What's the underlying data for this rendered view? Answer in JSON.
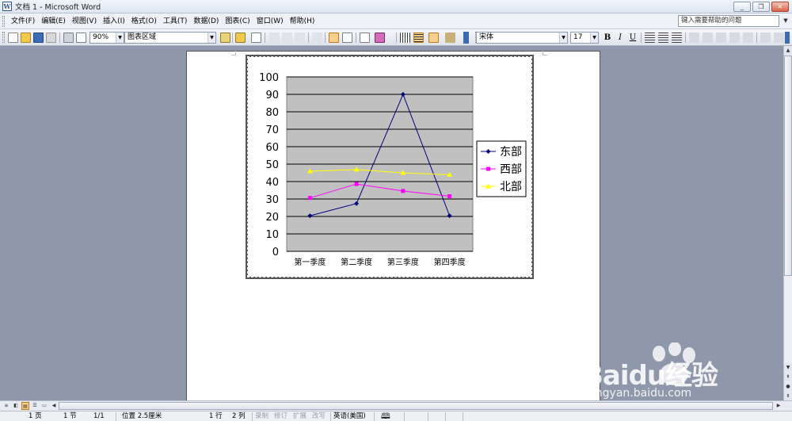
{
  "window": {
    "title": "文档 1 - Microsoft Word",
    "buttons": {
      "minimize": "_",
      "restore": "❐",
      "close": "✕"
    }
  },
  "menubar": {
    "items": [
      "文件(F)",
      "编辑(E)",
      "视图(V)",
      "插入(I)",
      "格式(O)",
      "工具(T)",
      "数据(D)",
      "图表(C)",
      "窗口(W)",
      "帮助(H)"
    ],
    "help_placeholder": "键入需要帮助的问题"
  },
  "toolbar": {
    "zoom": "90%",
    "chart_object": "图表区域",
    "font": "宋体",
    "font_size": "17",
    "bold": "B",
    "italic": "I",
    "underline": "U"
  },
  "chart_data": {
    "type": "line",
    "categories": [
      "第一季度",
      "第二季度",
      "第三季度",
      "第四季度"
    ],
    "series": [
      {
        "name": "东部",
        "values": [
          20.4,
          27.4,
          90,
          20.4
        ],
        "color": "#000080",
        "marker": "diamond"
      },
      {
        "name": "西部",
        "values": [
          30.6,
          38.6,
          34.6,
          31.6
        ],
        "color": "#ff00ff",
        "marker": "square"
      },
      {
        "name": "北部",
        "values": [
          45.9,
          46.9,
          45,
          43.9
        ],
        "color": "#ffff00",
        "marker": "triangle"
      }
    ],
    "y_ticks": [
      "0",
      "10",
      "20",
      "30",
      "40",
      "50",
      "60",
      "70",
      "80",
      "90",
      "100"
    ],
    "ylim": [
      0,
      100
    ],
    "plot_background": "#c0c0c0",
    "grid": true,
    "legend_position": "right"
  },
  "statusbar": {
    "page": "1 页",
    "section": "1 节",
    "page_of": "1/1",
    "position": "位置 2.5厘米",
    "line": "1 行",
    "column": "2 列",
    "rec": "录制",
    "trk": "修订",
    "ext": "扩展",
    "ovr": "改写",
    "language": "英语(美国)"
  },
  "watermark": {
    "brand": "Baidu经验",
    "url": "jingyan.baidu.com"
  }
}
